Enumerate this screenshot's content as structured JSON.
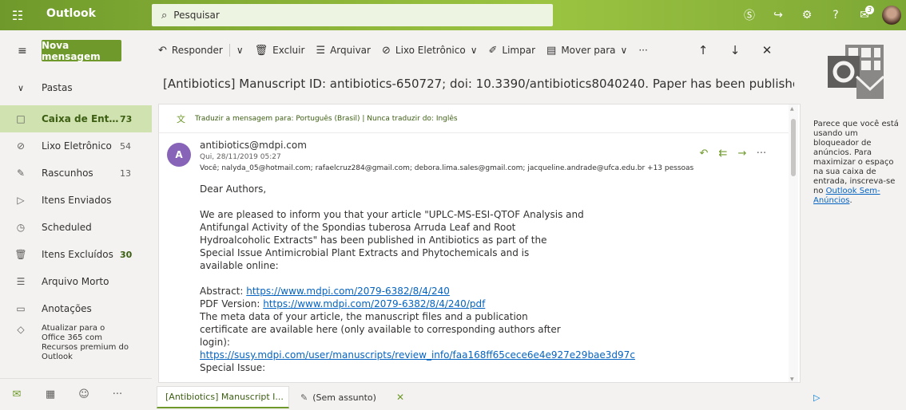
{
  "app": {
    "brand": "Outlook",
    "search_placeholder": "Pesquisar",
    "notifications_count": "3"
  },
  "toolbar": {
    "new_message": "Nova mensagem",
    "reply": "Responder",
    "delete": "Excluir",
    "archive": "Arquivar",
    "junk": "Lixo Eletrônico",
    "sweep": "Limpar",
    "move_to": "Mover para",
    "more": "···"
  },
  "folders": {
    "header": "Pastas",
    "items": [
      {
        "label": "Caixa de Entra...",
        "count": "73",
        "icon": "inbox-icon"
      },
      {
        "label": "Lixo Eletrônico",
        "count": "54",
        "icon": "junk-icon"
      },
      {
        "label": "Rascunhos",
        "count": "13",
        "icon": "pencil-icon"
      },
      {
        "label": "Itens Enviados",
        "count": "",
        "icon": "send-icon"
      },
      {
        "label": "Scheduled",
        "count": "",
        "icon": "clock-icon"
      },
      {
        "label": "Itens Excluídos",
        "count": "30",
        "icon": "trash-icon"
      },
      {
        "label": "Arquivo Morto",
        "count": "",
        "icon": "archive-icon"
      },
      {
        "label": "Anotações",
        "count": "",
        "icon": "note-icon"
      }
    ],
    "upgrade": "Atualizar para o Office 365 com Recursos premium do Outlook"
  },
  "message": {
    "subject": "[Antibiotics] Manuscript ID: antibiotics-650727; doi: 10.3390/antibiotics8040240. Paper has been published.",
    "translate_text": "Traduzir a mensagem para: Português (Brasil) | Nunca traduzir do: Inglês",
    "avatar_letter": "A",
    "sender": "antibiotics@mdpi.com",
    "date": "Qui, 28/11/2019 05:27",
    "recipients": "Você; nalyda_05@hotmail.com; rafaelcruz284@gmail.com; debora.lima.sales@gmail.com; jacqueline.andrade@ufca.edu.br +13 pessoas",
    "greeting": "Dear Authors,",
    "para1": [
      "We are pleased to inform you that your article \"UPLC-MS-ESI-QTOF Analysis and",
      "Antifungal Activity of the Spondias tuberosa Arruda Leaf and Root",
      "Hydroalcoholic Extracts\" has been published in Antibiotics as part of the",
      "Special Issue Antimicrobial Plant Extracts and Phytochemicals and is",
      "available online:"
    ],
    "abstract_label": "Abstract: ",
    "abstract_url": "https://www.mdpi.com/2079-6382/8/4/240",
    "pdf_label": "PDF Version: ",
    "pdf_url": "https://www.mdpi.com/2079-6382/8/4/240/pdf",
    "para2": [
      "The meta data of your article, the manuscript files and a publication",
      "certificate are available here (only available to corresponding authors after",
      "login):"
    ],
    "susy_url": "https://susy.mdpi.com/user/manuscripts/review_info/faa168ff65cece6e4e927e29bae3d97c",
    "special_issue": "Special Issue:"
  },
  "tabs": [
    {
      "label": "[Antibiotics] Manuscript I..."
    },
    {
      "label": "(Sem assunto)"
    }
  ],
  "ad": {
    "text_before": "Parece que você está usando um bloqueador de anúncios. Para maximizar o espaço na sua caixa de entrada, inscreva-se no ",
    "link": "Outlook Sem-Anúncios",
    "text_after": "."
  },
  "colors": {
    "accent": "#6f9a2b",
    "selected_folder": "#cfe2b0",
    "avatar": "#8764b8",
    "link": "#0563c1"
  }
}
